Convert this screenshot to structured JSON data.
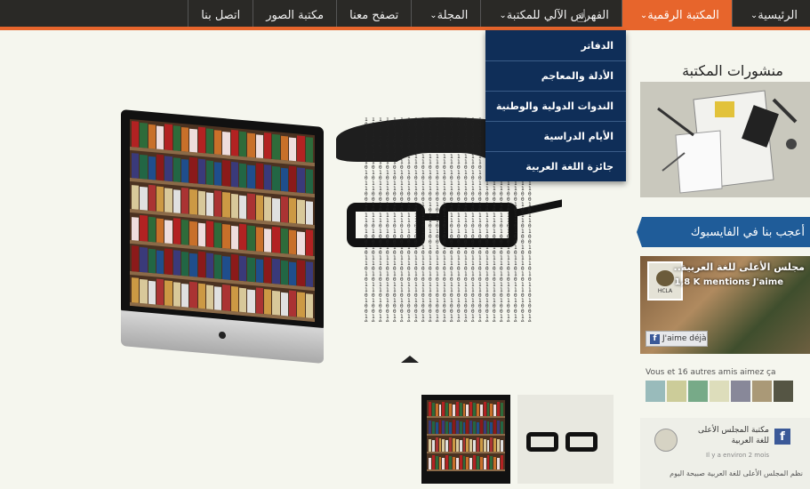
{
  "nav": {
    "items": [
      {
        "label": "الرئيسية",
        "has_dropdown": true,
        "active": false
      },
      {
        "label": "المكتبة الرقمية",
        "has_dropdown": true,
        "active": true
      },
      {
        "label": "الفهرس الآلي للمكتبة",
        "has_dropdown": true,
        "active": false
      },
      {
        "label": "المجلة",
        "has_dropdown": true,
        "active": false
      },
      {
        "label": "تصفح معنا",
        "has_dropdown": false,
        "active": false
      },
      {
        "label": "مكتبة الصور",
        "has_dropdown": false,
        "active": false
      },
      {
        "label": "اتصل بنا",
        "has_dropdown": false,
        "active": false
      }
    ],
    "chevron": "⌄"
  },
  "dropdown": {
    "items": [
      "الدفاتر",
      "الأدلة والمعاجم",
      "الندوات الدولية والوطنية",
      "الأيام الدراسية",
      "جائزة اللغة العربية"
    ]
  },
  "sidebar": {
    "publications_title": "منشورات المكتبة",
    "facebook_title": "أعجب بنا في الفايسبوك",
    "fb_page_name": "مجلس الأعلى للغة العربية..",
    "fb_likes": "1,8 K mentions J'aime",
    "fb_avatar_text": "HCLA",
    "fb_like_button": "J'aime déjà",
    "fb_friends_text": "Vous et 16 autres amis aimez ça",
    "fb_post_name": "مكتبة المجلس الأعلى للغة العربية",
    "fb_post_time": "Il y a environ 2 mois",
    "fb_post_text": "نظم المجلس الأعلى للغة العربية صبيحة اليوم"
  },
  "colors": {
    "nav_bg": "#2a2926",
    "accent_orange": "#e7652c",
    "dropdown_bg": "#0f2e58",
    "facebook_blue": "#1f5c99"
  }
}
